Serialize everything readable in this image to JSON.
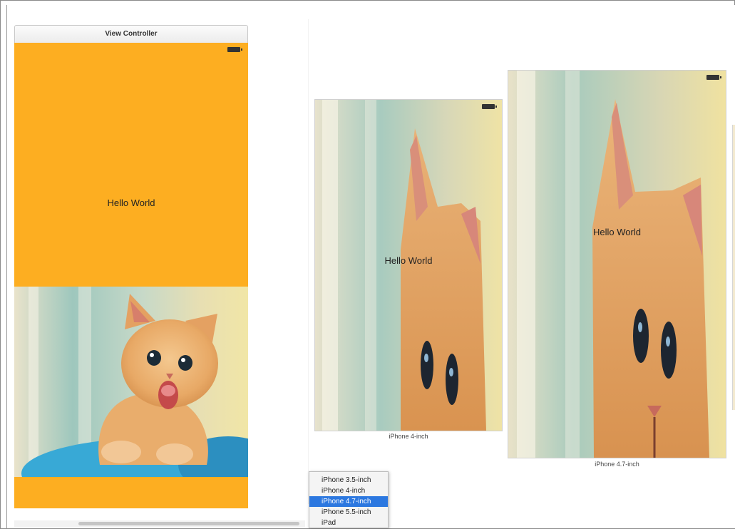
{
  "storyboard": {
    "scene_title": "View Controller",
    "label_text": "Hello World"
  },
  "preview": {
    "devices": [
      {
        "label": "iPhone 4-inch",
        "label_text": "Hello World"
      },
      {
        "label": "iPhone 4.7-inch",
        "label_text": "Hello World"
      }
    ]
  },
  "device_menu": {
    "items": [
      {
        "label": "iPhone 3.5-inch",
        "selected": false
      },
      {
        "label": "iPhone 4-inch",
        "selected": false
      },
      {
        "label": "iPhone 4.7-inch",
        "selected": true
      },
      {
        "label": "iPhone 5.5-inch",
        "selected": false
      },
      {
        "label": "iPad",
        "selected": false
      }
    ]
  },
  "colors": {
    "view_background": "#fdae21",
    "menu_highlight": "#2c78e0"
  }
}
